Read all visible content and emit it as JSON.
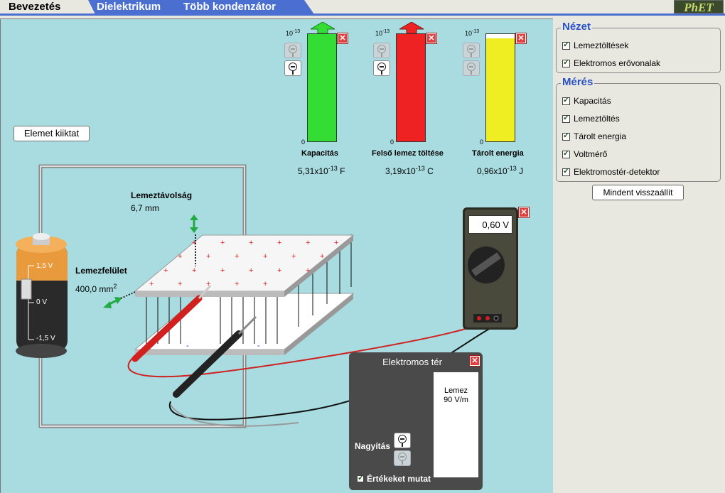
{
  "tabs": [
    {
      "label": "Bevezetés"
    },
    {
      "label": "Dielektrikum"
    },
    {
      "label": "Több kondenzátor"
    }
  ],
  "logo": "PhET",
  "colors": {
    "canvas_bg": "#a8dce0",
    "tab_blue": "#4b6fd0",
    "title_blue": "#2a52c8",
    "capacitance": "#33dd33",
    "charge": "#ee2222",
    "energy": "#eeee22"
  },
  "battery_button": "Elemet kiiktat",
  "battery": {
    "top": "1,5 V",
    "mid": "0 V",
    "bottom": "-1,5 V"
  },
  "plate_separation": {
    "label": "Lemeztávolság",
    "value": "6,7 mm"
  },
  "plate_area": {
    "label": "Lemezfelület",
    "value": "400,0 mm",
    "sup": "2"
  },
  "meters": [
    {
      "exp": "10",
      "sup": "-13",
      "zero": "0",
      "name": "Kapacitás",
      "value": "5,31x10",
      "value_sup": "-13",
      "unit": "F",
      "fill": 1.0
    },
    {
      "exp": "10",
      "sup": "-13",
      "zero": "0",
      "name": "Felső lemez töltése",
      "value": "3,19x10",
      "value_sup": "-13",
      "unit": "C",
      "fill": 1.0
    },
    {
      "exp": "10",
      "sup": "-13",
      "zero": "0",
      "name": "Tárolt energia",
      "value": "0,96x10",
      "value_sup": "-13",
      "unit": "J",
      "fill": 0.96
    }
  ],
  "voltmeter": {
    "reading": "0,60 V"
  },
  "efield": {
    "title": "Elektromos tér",
    "line1": "Lemez",
    "line2": "90 V/m",
    "zoom_label": "Nagyítás",
    "show_values": "Értékeket mutat"
  },
  "panel": {
    "view_title": "Nézet",
    "view_items": [
      "Lemeztöltések",
      "Elektromos erővonalak"
    ],
    "measure_title": "Mérés",
    "measure_items": [
      "Kapacitás",
      "Lemeztöltés",
      "Tárolt energia",
      "Voltmérő",
      "Elektromostér-detektor"
    ],
    "reset": "Mindent visszaállít"
  }
}
